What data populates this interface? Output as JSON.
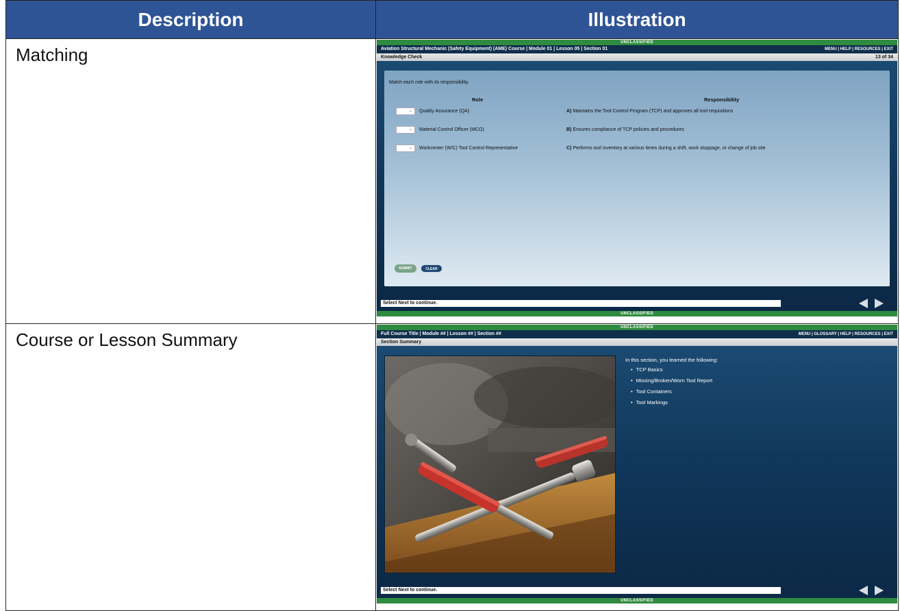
{
  "table": {
    "headers": {
      "description": "Description",
      "illustration": "Illustration"
    },
    "rows": [
      {
        "description": "Matching"
      },
      {
        "description": "Course or Lesson Summary"
      }
    ]
  },
  "colors": {
    "header_bg": "#2f5496",
    "classification_bar": "#2e8b3f",
    "title_bar": "#0f2f4c",
    "stage_bg": "#0f3558"
  },
  "matching": {
    "classification_top": "UNCLASSIFIED",
    "classification_bottom": "UNCLASSIFIED",
    "course_title": "Aviation Structural Mechanic (Safety Equipment) (AME) Course | Module 01 | Lesson 05 | Section 01",
    "menu": "MENU | HELP | RESOURCES | EXIT",
    "section_title": "Knowledge Check",
    "page_counter": "13 of 34",
    "instruction": "Match each role with its responsibility.",
    "role_header": "Role",
    "responsibility_header": "Responsibility",
    "roles": [
      {
        "dropdown_value": "⌄",
        "label": "Quality Assurance (QA)"
      },
      {
        "dropdown_value": "⌄",
        "label": "Material Control Officer (MCO)"
      },
      {
        "dropdown_value": "⌄",
        "label": "Workcenter (W/C) Tool Control Representative"
      }
    ],
    "responsibilities": [
      {
        "letter": "A)",
        "text": "Maintains the Tool Control Program (TCP) and approves all tool requisitions"
      },
      {
        "letter": "B)",
        "text": "Ensures compliance of TCP policies and procedures"
      },
      {
        "letter": "C)",
        "text": "Performs tool inventory at various times during a shift, work stoppage, or change of job site"
      }
    ],
    "submit_label": "SUBMIT",
    "clear_label": "CLEAR",
    "status": "Select Next to continue."
  },
  "summary": {
    "classification_top": "UNCLASSIFIED",
    "classification_bottom": "UNCLASSIFIED",
    "course_title": "Full Course Title | Module ## | Lesson ## | Section ##",
    "menu": "MENU | GLOSSARY | HELP | RESOURCES | EXIT",
    "section_title": "Section Summary",
    "intro": "In this section, you learned the following:",
    "items": [
      "TCP Basics",
      "Missing/Broken/Worn Tool Report",
      "Tool Containers",
      "Tool Markings"
    ],
    "status": "Select Next to continue."
  }
}
